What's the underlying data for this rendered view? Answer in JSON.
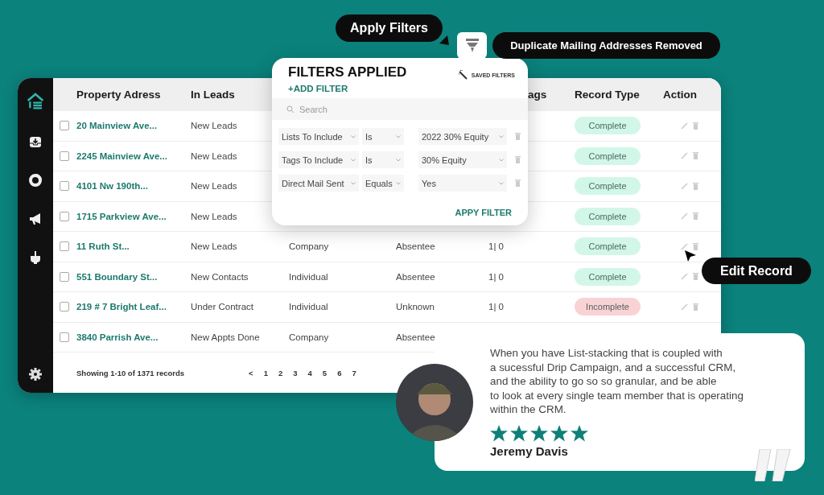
{
  "callouts": {
    "apply_filters": "Apply Filters",
    "duplicates": "Duplicate Mailing Addresses Removed",
    "edit_record": "Edit Record"
  },
  "filters_panel": {
    "title": "FILTERS APPLIED",
    "add_filter": "+ADD FILTER",
    "saved_filters": "SAVED FILTERS",
    "search_placeholder": "Search",
    "apply": "APPY FILTER",
    "filters": [
      {
        "field": "Lists To Include",
        "operator": "Is",
        "value": "2022 30% Equity"
      },
      {
        "field": "Tags To Include",
        "operator": "Is",
        "value": "30% Equity"
      },
      {
        "field": "Direct Mail Sent",
        "operator": "Equals",
        "value": "Yes"
      }
    ]
  },
  "table": {
    "header": {
      "address": "Property Adress",
      "in_leads": "In Leads",
      "column_5": "ags",
      "record_type": "Record Type",
      "action": "Action"
    },
    "rows": [
      {
        "checked": false,
        "address": "20 Mainview Ave...",
        "in_leads": "New Leads",
        "record_type": "Complete",
        "color": "#d2f7e9"
      },
      {
        "checked": false,
        "address": "2245 Mainview Ave...",
        "in_leads": "New Leads",
        "record_type": "Complete",
        "color": "#d2f7e9"
      },
      {
        "checked": false,
        "address": "4101 Nw 190th...",
        "in_leads": "New Leads",
        "record_type": "Complete",
        "color": "#d2f7e9"
      },
      {
        "checked": false,
        "address": "1715 Parkview Ave...",
        "in_leads": "New Leads",
        "record_type": "Complete",
        "color": "#d2f7e9"
      },
      {
        "checked": false,
        "address": "11 Ruth St...",
        "in_leads": "New Leads",
        "column_3": "Company",
        "column_4": "Absentee",
        "column_5": "1| 0",
        "record_type": "Complete",
        "color": "#d2f7e9"
      },
      {
        "checked": false,
        "address": "551 Boundary St...",
        "in_leads": "New Contacts",
        "column_3": "Individual",
        "column_4": "Absentee",
        "column_5": "1| 0",
        "record_type": "Complete",
        "color": "#d2f7e9"
      },
      {
        "checked": false,
        "address": "219 # 7 Bright Leaf...",
        "in_leads": "Under Contract",
        "column_3": "Individual",
        "column_4": "Unknown",
        "column_5": "1| 0",
        "record_type": "Incomplete",
        "color": "#f9d2d6"
      },
      {
        "checked": false,
        "address": "3840 Parrish Ave...",
        "in_leads": "New Appts Done",
        "column_3": "Company",
        "column_4": "Absentee"
      }
    ],
    "footer": "Showing 1-10 of 1371 records",
    "pagination": {
      "prev": "<",
      "pages": [
        "1",
        "2",
        "3",
        "4",
        "5",
        "6",
        "7"
      ]
    }
  },
  "testimonial": {
    "quote": "When you have List-stacking that is coupled with\na sucessful Drip Campaign, and a successful CRM,\nand the ability to go so so granular, and be able\nto look at every single team member that is operating\nwithin the CRM.",
    "stars": 5,
    "name": "Jeremy Davis"
  }
}
